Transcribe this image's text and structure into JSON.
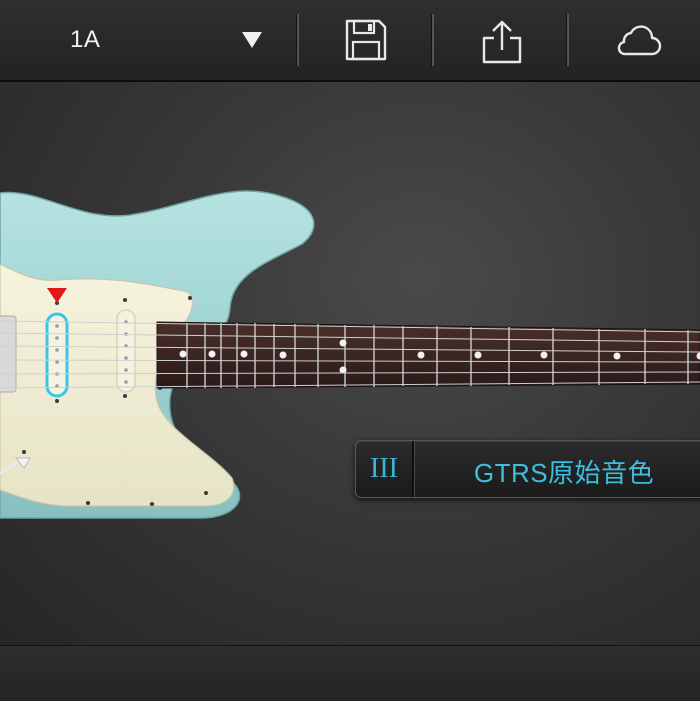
{
  "toolbar": {
    "preset_label": "1A",
    "preset_dropdown_icon": "triangle-down-icon",
    "save_icon": "floppy-disk-icon",
    "share_icon": "share-upload-icon",
    "cloud_icon": "cloud-icon"
  },
  "guitar": {
    "body_color": "#9ed3d3",
    "pickguard_color": "#f1efd4",
    "fretboard_color": "#3a2522",
    "pickup_selected_color": "#3ac6e6",
    "selection_marker_color": "#e5161a"
  },
  "tone_selector": {
    "mode_label": "III",
    "tone_name": "GTRS原始音色",
    "accent_color": "#3cbfe0"
  }
}
